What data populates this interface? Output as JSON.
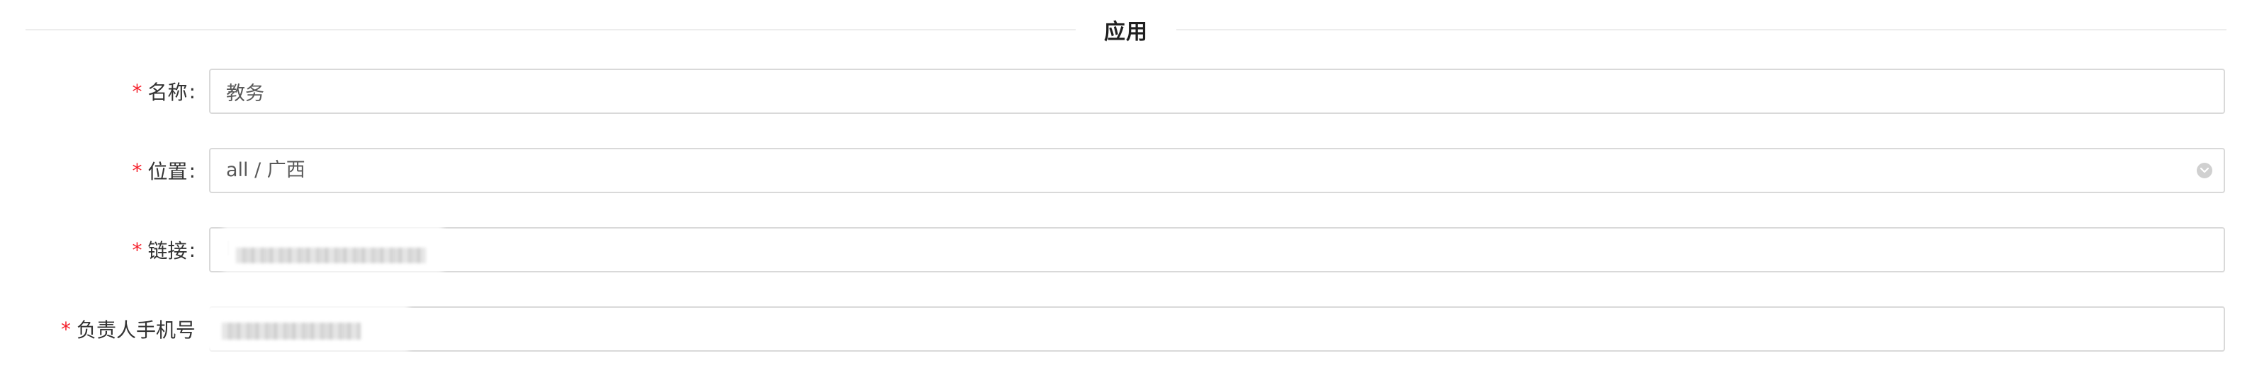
{
  "section": {
    "title": "应用"
  },
  "form": {
    "required_mark": "*",
    "colon": ":",
    "name": {
      "label": "名称",
      "value": "教务"
    },
    "location": {
      "label": "位置",
      "value": "all / 广西",
      "icon": "chevron-down-icon"
    },
    "link": {
      "label": "链接",
      "visible_prefix": "h"
    },
    "phone": {
      "label": "负责人手机号"
    }
  },
  "colors": {
    "required": "#f5222d",
    "border": "#d9d9d9",
    "divider": "#ededed"
  }
}
